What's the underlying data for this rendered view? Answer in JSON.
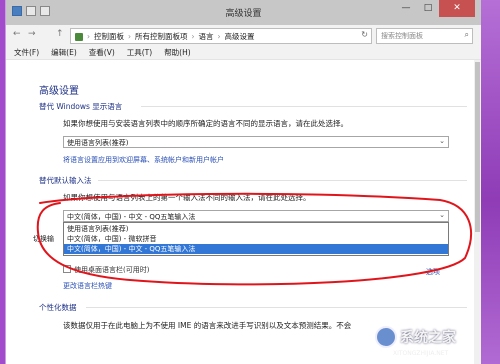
{
  "window": {
    "title": "高级设置",
    "minimize": "—",
    "maximize": "□",
    "close": "✕"
  },
  "nav": {
    "back": "←",
    "forward": "→",
    "up": "↑"
  },
  "address": {
    "crumbs": [
      "控制面板",
      "所有控制面板项",
      "语言",
      "高级设置"
    ],
    "sep": "›",
    "refresh": "↻"
  },
  "search": {
    "placeholder": "搜索控制面板"
  },
  "menu": [
    "文件(F)",
    "编辑(E)",
    "查看(V)",
    "工具(T)",
    "帮助(H)"
  ],
  "page": {
    "heading": "高级设置",
    "display_lang": {
      "title": "替代 Windows 显示语言",
      "desc": "如果你想使用与安装语言列表中的顺序所确定的语言不同的显示语言，请在此处选择。",
      "combo_value": "使用语言列表(推荐)",
      "link": "将语言设置应用到欢迎屏幕、系统帐户和新用户帐户"
    },
    "input_method": {
      "title": "替代默认输入法",
      "desc": "如果你想使用与语言列表上的第一个输入法不同的输入法，请在此处选择。",
      "combo_value": "中文(简体，中国) - 中文 - QQ五笔输入法",
      "options": [
        "使用语言列表(推荐)",
        "中文(简体，中国) - 微软拼音",
        "中文(简体，中国) - 中文 - QQ五笔输入法"
      ],
      "selected_index": 2,
      "checkbox_label": "使用桌面语言栏(可用时)",
      "options_link": "选项",
      "hotkeys_link": "更改语言栏热键",
      "switch_label": "切换输"
    },
    "personal": {
      "title": "个性化数据",
      "desc": "该数据仅用于在此电脑上为不使用 IME 的语言来改进手写识别以及文本预测结果。不会"
    }
  },
  "watermark": {
    "text": "系统之家",
    "url": "XITONGZHIJIA.NET"
  },
  "colors": {
    "annotation": "#e0151b",
    "link": "#2a4fb6",
    "heading": "#1e3287",
    "highlight": "#3277d6"
  }
}
